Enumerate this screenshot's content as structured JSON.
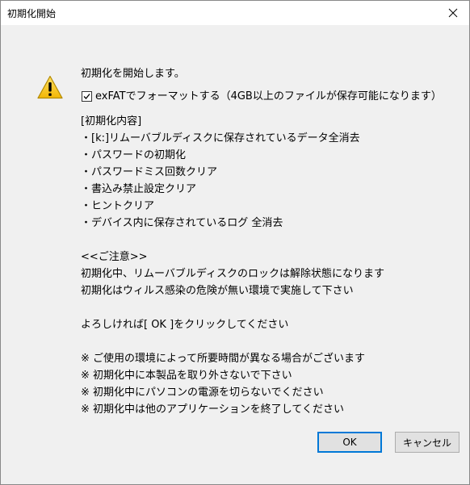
{
  "dialog": {
    "title": "初期化開始",
    "close_glyph": "✕"
  },
  "icon": {
    "name": "warning-icon",
    "colors": {
      "fill": "#f5c211",
      "stroke": "#b38a00",
      "mark": "#000000"
    }
  },
  "message": {
    "intro": "初期化を開始します。",
    "checkbox": {
      "label": "exFATでフォーマットする（4GB以上のファイルが保存可能になります）",
      "checked": true
    },
    "contents_header": "[初期化内容]",
    "contents_items": [
      "・[k:]リムーバブルディスクに保存されているデータ全消去",
      "・パスワードの初期化",
      "・パスワードミス回数クリア",
      "・書込み禁止設定クリア",
      "・ヒントクリア",
      "・デバイス内に保存されているログ 全消去"
    ],
    "caution_header": "<<ご注意>>",
    "caution_items": [
      "初期化中、リムーバブルディスクのロックは解除状態になります",
      "初期化はウィルス感染の危険が無い環境で実施して下さい"
    ],
    "confirm": "よろしければ[ OK ]をクリックしてください",
    "notes": [
      "※ ご使用の環境によって所要時間が異なる場合がございます",
      "※ 初期化中に本製品を取り外さないで下さい",
      "※ 初期化中にパソコンの電源を切らないでください",
      "※ 初期化中は他のアプリケーションを終了してください"
    ]
  },
  "buttons": {
    "ok": "OK",
    "cancel": "キャンセル"
  }
}
